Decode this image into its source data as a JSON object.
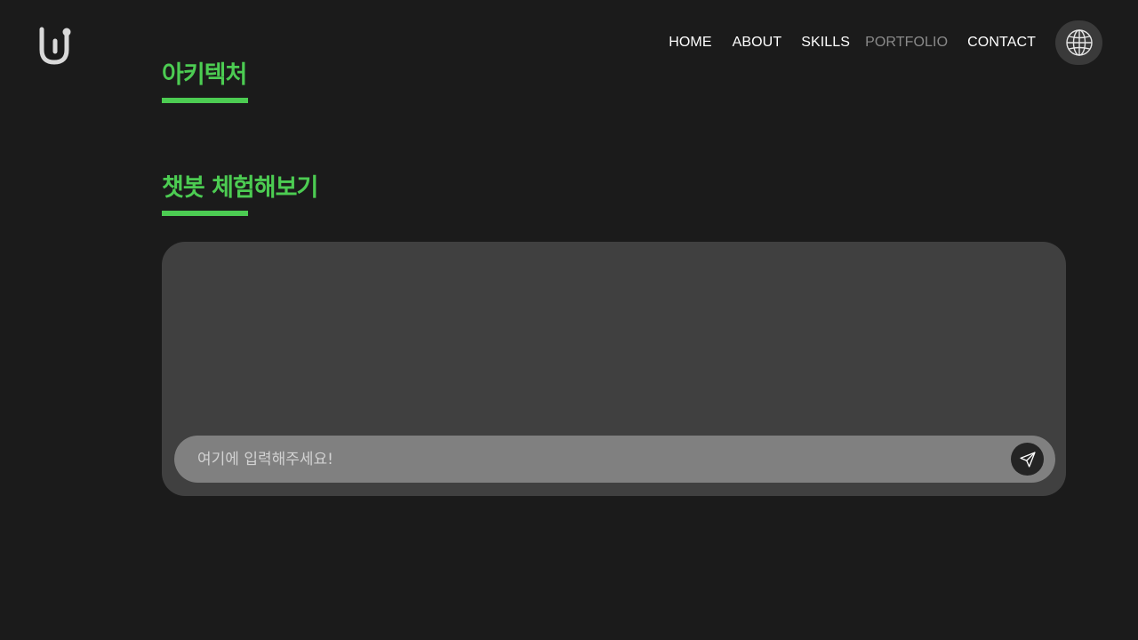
{
  "logo": {
    "icon": "uj-logo-icon",
    "color": "#d9d9d9"
  },
  "nav": {
    "items": [
      {
        "label": "HOME",
        "active": false
      },
      {
        "label": "ABOUT",
        "active": false
      },
      {
        "label": "SKILLS",
        "active": false
      },
      {
        "label": "PORTFOLIO",
        "active": true
      },
      {
        "label": "CONTACT",
        "active": false
      }
    ],
    "language_icon": "globe-icon"
  },
  "sections": {
    "architecture": {
      "title": "아키텍처"
    },
    "chatbot": {
      "title": "챗봇 체험해보기"
    }
  },
  "chat": {
    "input": {
      "placeholder": "여기에 입력해주세요!",
      "value": ""
    },
    "send_icon": "send-icon"
  },
  "colors": {
    "background": "#1b1b1b",
    "accent": "#4ccc52",
    "panel": "#404040",
    "input_bar": "#808080",
    "nav_active": "#8a8a8a"
  }
}
